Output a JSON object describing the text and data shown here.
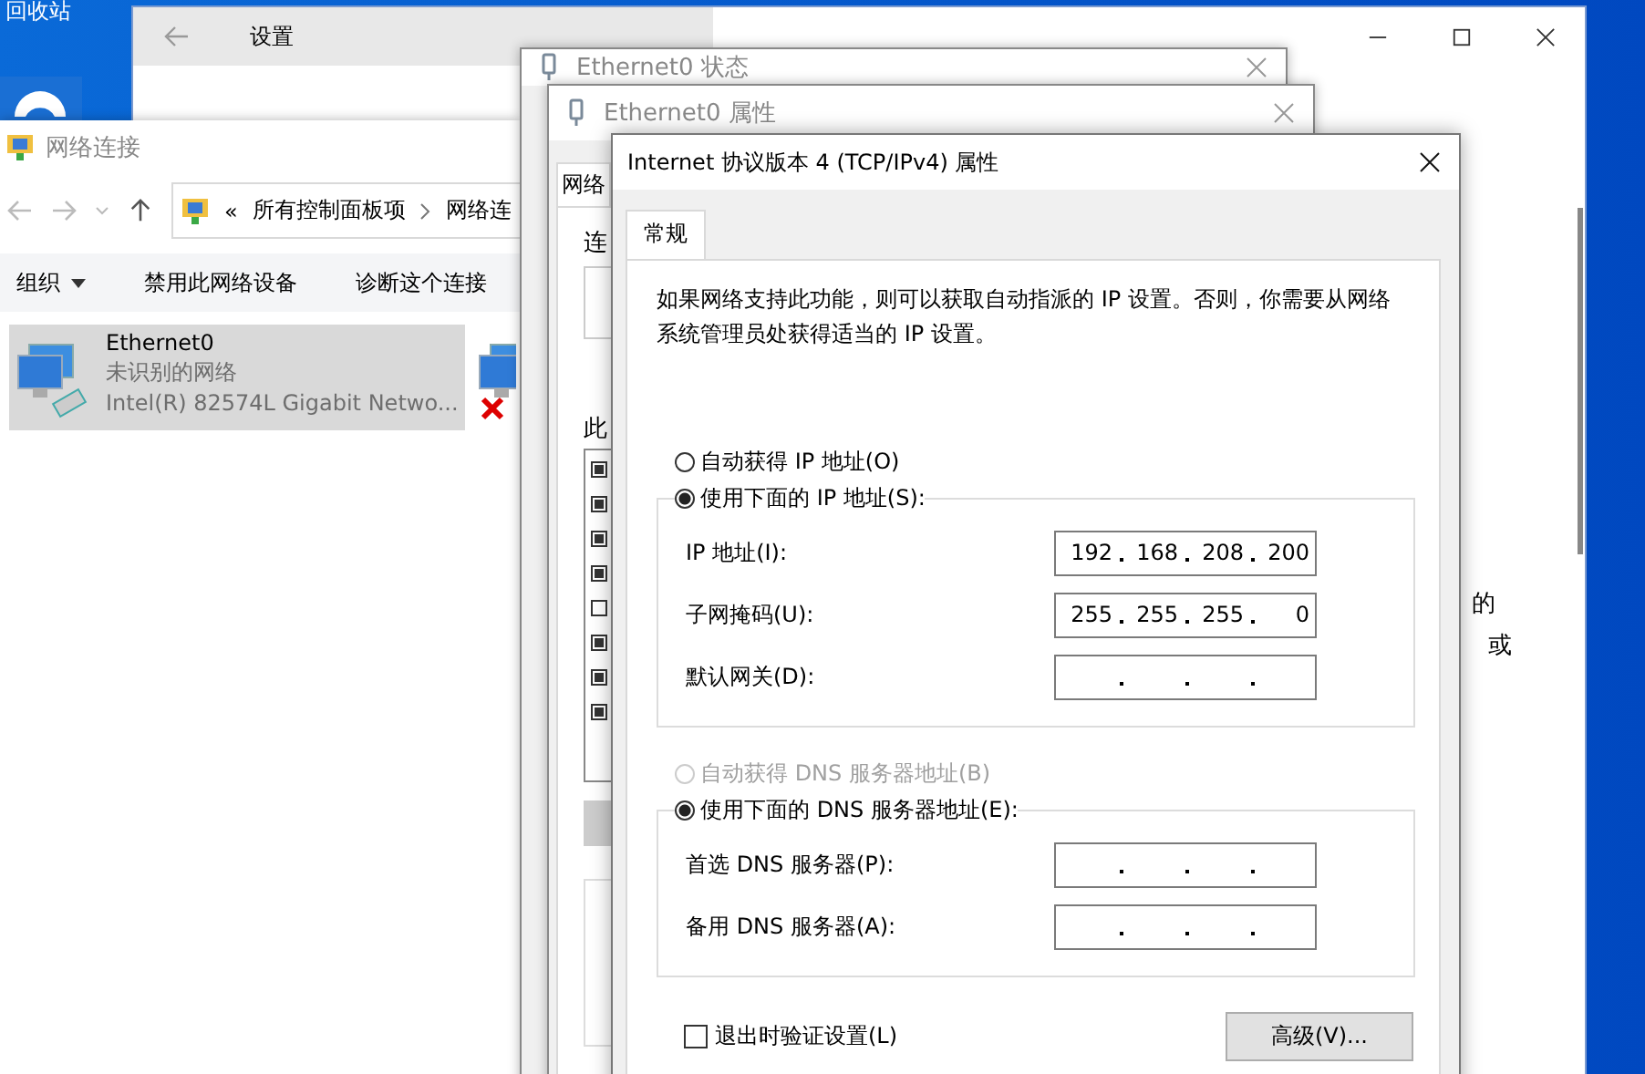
{
  "desktop": {
    "icon_label": "回收站"
  },
  "settings_window": {
    "title": "设置",
    "fragments": [
      "的",
      "或"
    ]
  },
  "network_window": {
    "title": "网络连接",
    "overflow": "«",
    "breadcrumb": [
      "所有控制面板项",
      "网络连"
    ],
    "toolbar": [
      {
        "label": "组织",
        "dropdown": true
      },
      {
        "label": "禁用此网络设备",
        "dropdown": false
      },
      {
        "label": "诊断这个连接",
        "dropdown": false
      }
    ],
    "adapters": [
      {
        "name": "Ethernet0",
        "status": "未识别的网络",
        "device": "Intel(R) 82574L Gigabit Netwo...",
        "selected": true,
        "disconnected": false
      },
      {
        "selected": false,
        "disconnected": true
      }
    ]
  },
  "status_window": {
    "title": "Ethernet0 状态"
  },
  "properties_window": {
    "title": "Ethernet0 属性",
    "tab": "网络",
    "label_1": "连",
    "label_2": "此",
    "components": [
      {
        "checked": true
      },
      {
        "checked": true
      },
      {
        "checked": true
      },
      {
        "checked": true
      },
      {
        "checked": false
      },
      {
        "checked": true
      },
      {
        "checked": true
      },
      {
        "checked": true
      }
    ]
  },
  "ipv4_dialog": {
    "title": "Internet 协议版本 4 (TCP/IPv4) 属性",
    "tabs": [
      {
        "label": "常规",
        "selected": true
      }
    ],
    "description": "如果网络支持此功能，则可以获取自动指派的 IP 设置。否则，你需要从网络系统管理员处获得适当的 IP 设置。",
    "ip_mode": [
      {
        "label": "自动获得 IP 地址(O)",
        "selected": false,
        "disabled": false
      },
      {
        "label": "使用下面的 IP 地址(S):",
        "selected": true,
        "disabled": false
      }
    ],
    "ip_fields": [
      {
        "label": "IP 地址(I):",
        "octets": [
          "192",
          "168",
          "208",
          "200"
        ]
      },
      {
        "label": "子网掩码(U):",
        "octets": [
          "255",
          "255",
          "255",
          "0"
        ]
      },
      {
        "label": "默认网关(D):"
      }
    ],
    "dns_mode": [
      {
        "label": "自动获得 DNS 服务器地址(B)",
        "selected": false,
        "disabled": true
      },
      {
        "label": "使用下面的 DNS 服务器地址(E):",
        "selected": true,
        "disabled": false
      }
    ],
    "dns_fields": [
      {
        "label": "首选 DNS 服务器(P):"
      },
      {
        "label": "备用 DNS 服务器(A):"
      }
    ],
    "validate_on_exit": {
      "label": "退出时验证设置(L)",
      "checked": false
    },
    "advanced_button": "高级(V)..."
  }
}
